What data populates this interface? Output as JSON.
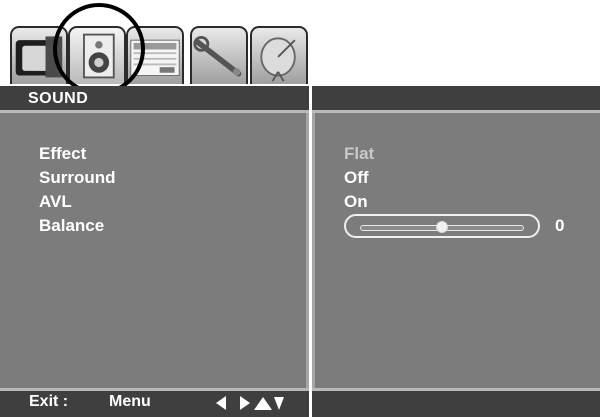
{
  "tabs": [
    {
      "name": "picture",
      "icon": "tv-icon"
    },
    {
      "name": "sound",
      "icon": "speaker-icon",
      "active": true
    },
    {
      "name": "channel",
      "icon": "calendar-icon"
    },
    {
      "name": "setup",
      "icon": "wrench-icon"
    },
    {
      "name": "source",
      "icon": "satellite-dish-icon"
    }
  ],
  "menu": {
    "title": "SOUND",
    "items": [
      {
        "label": "Effect",
        "value": "Flat",
        "disabled": true
      },
      {
        "label": "Surround",
        "value": "Off"
      },
      {
        "label": "AVL",
        "value": "On"
      },
      {
        "label": "Balance",
        "value": "0",
        "slider_level": 0.5
      }
    ]
  },
  "footer": {
    "exit_label": "Exit :",
    "menu_label": "Menu",
    "nav_arrows": [
      "left",
      "right",
      "up",
      "down"
    ]
  },
  "colors": {
    "panel": "#7c7c7c",
    "bar": "#3f3f3f",
    "text": "#ffffff",
    "disabled_text": "#c9c9c9"
  }
}
